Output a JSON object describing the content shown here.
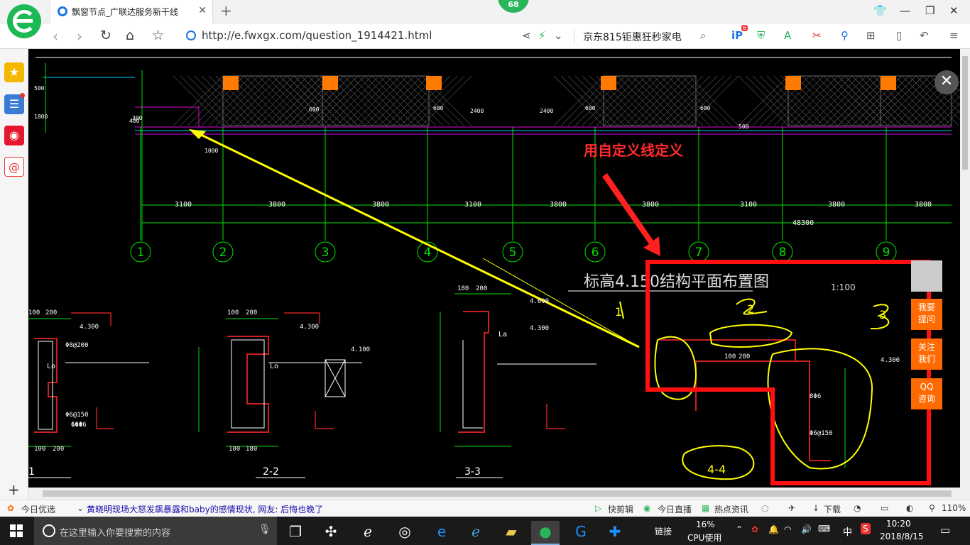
{
  "tab": {
    "title": "飘窗节点_广联达服务新干线"
  },
  "badge": "68",
  "address": {
    "url": "http://e.fwxgx.com/question_1914421.html"
  },
  "search": {
    "text": "京东815钜惠狂秒家电"
  },
  "extension_badge": "6",
  "drawing": {
    "annotation": "用自定义线定义",
    "plan_title": "标高4.150结构平面布置图",
    "scale": "1:100",
    "axis_labels": [
      "1",
      "2",
      "3",
      "4",
      "5",
      "6",
      "7",
      "8",
      "9"
    ],
    "spans": [
      "3100",
      "3800",
      "3800",
      "3100",
      "3800",
      "3800",
      "3100",
      "3800",
      "3800"
    ],
    "total_dim": "48300",
    "handwritten": [
      "1",
      "2",
      "3",
      "4-4"
    ],
    "sections": [
      "1",
      "2-2",
      "3-3"
    ],
    "top_dims": [
      "500",
      "1800",
      "300",
      "400",
      "600",
      "600",
      "2400",
      "2400",
      "600",
      "600",
      "500",
      "1000"
    ],
    "elev": [
      "4.300",
      "4.300",
      "4.600",
      "4.300",
      "4.100",
      "4.300"
    ],
    "rebar": [
      "Φ8@200",
      "Φ6@150",
      "6Φ8",
      "16Φ6",
      "8Φ6",
      "Φ6@150"
    ],
    "sect_dims": [
      "100",
      "200",
      "100",
      "200",
      "180",
      "200",
      "100",
      "200",
      "100",
      "200",
      "100",
      "180"
    ],
    "side_labels": [
      "Lo",
      "Lo",
      "La"
    ]
  },
  "float_buttons": [
    "我要\n提问",
    "关注\n我们",
    "QQ\n咨询"
  ],
  "statusbar": {
    "today": "今日优选",
    "news": "黄晓明现场大怒发飙暴露和baby的感情现状, 网友: 后悔也晚了",
    "kuaijian": "快剪辑",
    "zhibo": "今日直播",
    "redian": "热点资讯",
    "download": "下载",
    "zoom": "110%"
  },
  "taskbar": {
    "search_placeholder": "在这里输入你要搜索的内容",
    "link": "链接",
    "cpu_pct": "16%",
    "cpu_label": "CPU使用",
    "ime": "中",
    "time": "10:20",
    "date": "2018/8/15"
  }
}
